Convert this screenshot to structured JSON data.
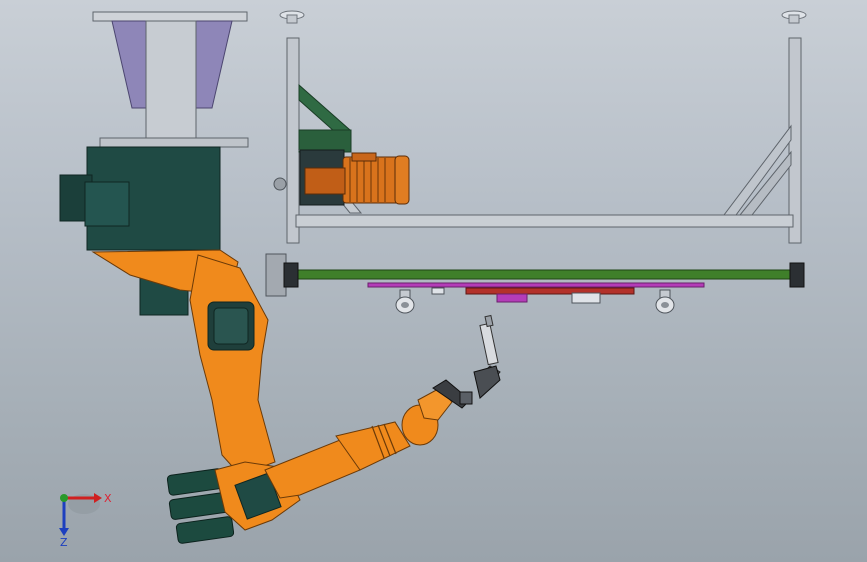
{
  "app": {
    "name": "CAD 3D viewport"
  },
  "viewport": {
    "background_top": "#c9cfd6",
    "background_bottom": "#9aa3ab"
  },
  "model": {
    "parts": [
      "mounting-pedestal",
      "robot-base",
      "robot-lower-arm",
      "robot-upper-arm",
      "welding-torch",
      "positioner-frame",
      "drive-motor",
      "guide-rail"
    ],
    "colors": {
      "robot_orange": "#f08a1c",
      "robot_dark": "#1f4a44",
      "frame_gray": "#b9bec6",
      "motor_orange": "#d9731c",
      "rail_green": "#3f7f2a",
      "rail_magenta": "#b43cb8",
      "brace_green": "#2f6a43",
      "flange_red": "#b3312a"
    }
  },
  "axis_triad": {
    "x_label": "X",
    "z_label": "Z",
    "x_color": "#d02020",
    "y_color": "#2a9a2a",
    "z_color": "#1d3fbf"
  }
}
